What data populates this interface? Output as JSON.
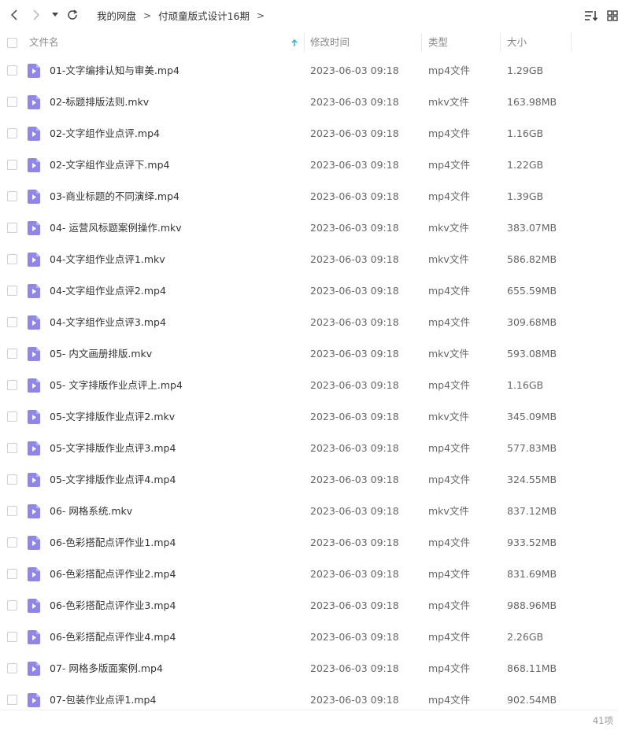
{
  "nav": {
    "back_icon": "chevron-left-icon",
    "forward_icon": "chevron-right-icon",
    "history_icon": "caret-down-icon",
    "refresh_icon": "refresh-icon"
  },
  "breadcrumb": {
    "items": [
      "我的网盘",
      "付顽童版式设计16期"
    ],
    "separator": ">"
  },
  "toolbar": {
    "sort_icon": "sort-list-icon",
    "view_icon": "grid-view-icon"
  },
  "columns": {
    "name": "文件名",
    "modified": "修改时间",
    "type": "类型",
    "size": "大小",
    "sort_icon": "sort-ascending-arrow-icon"
  },
  "colors": {
    "file_icon": "#8f86e8",
    "sort_arrow": "#2aa7c9"
  },
  "files": [
    {
      "name": "01-文字编排认知与审美.mp4",
      "modified": "2023-06-03 09:18",
      "type": "mp4文件",
      "size": "1.29GB"
    },
    {
      "name": "02-标题排版法则.mkv",
      "modified": "2023-06-03 09:18",
      "type": "mkv文件",
      "size": "163.98MB"
    },
    {
      "name": "02-文字组作业点评.mp4",
      "modified": "2023-06-03 09:18",
      "type": "mp4文件",
      "size": "1.16GB"
    },
    {
      "name": "02-文字组作业点评下.mp4",
      "modified": "2023-06-03 09:18",
      "type": "mp4文件",
      "size": "1.22GB"
    },
    {
      "name": "03-商业标题的不同演绎.mp4",
      "modified": "2023-06-03 09:18",
      "type": "mp4文件",
      "size": "1.39GB"
    },
    {
      "name": "04- 运营风标题案例操作.mkv",
      "modified": "2023-06-03 09:18",
      "type": "mkv文件",
      "size": "383.07MB"
    },
    {
      "name": "04-文字组作业点评1.mkv",
      "modified": "2023-06-03 09:18",
      "type": "mkv文件",
      "size": "586.82MB"
    },
    {
      "name": "04-文字组作业点评2.mp4",
      "modified": "2023-06-03 09:18",
      "type": "mp4文件",
      "size": "655.59MB"
    },
    {
      "name": "04-文字组作业点评3.mp4",
      "modified": "2023-06-03 09:18",
      "type": "mp4文件",
      "size": "309.68MB"
    },
    {
      "name": "05- 内文画册排版.mkv",
      "modified": "2023-06-03 09:18",
      "type": "mkv文件",
      "size": "593.08MB"
    },
    {
      "name": "05- 文字排版作业点评上.mp4",
      "modified": "2023-06-03 09:18",
      "type": "mp4文件",
      "size": "1.16GB"
    },
    {
      "name": "05-文字排版作业点评2.mkv",
      "modified": "2023-06-03 09:18",
      "type": "mkv文件",
      "size": "345.09MB"
    },
    {
      "name": "05-文字排版作业点评3.mp4",
      "modified": "2023-06-03 09:18",
      "type": "mp4文件",
      "size": "577.83MB"
    },
    {
      "name": "05-文字排版作业点评4.mp4",
      "modified": "2023-06-03 09:18",
      "type": "mp4文件",
      "size": "324.55MB"
    },
    {
      "name": "06- 网格系统.mkv",
      "modified": "2023-06-03 09:18",
      "type": "mkv文件",
      "size": "837.12MB"
    },
    {
      "name": "06-色彩搭配点评作业1.mp4",
      "modified": "2023-06-03 09:18",
      "type": "mp4文件",
      "size": "933.52MB"
    },
    {
      "name": "06-色彩搭配点评作业2.mp4",
      "modified": "2023-06-03 09:18",
      "type": "mp4文件",
      "size": "831.69MB"
    },
    {
      "name": "06-色彩搭配点评作业3.mp4",
      "modified": "2023-06-03 09:18",
      "type": "mp4文件",
      "size": "988.96MB"
    },
    {
      "name": "06-色彩搭配点评作业4.mp4",
      "modified": "2023-06-03 09:18",
      "type": "mp4文件",
      "size": "2.26GB"
    },
    {
      "name": "07- 网格多版面案例.mp4",
      "modified": "2023-06-03 09:18",
      "type": "mp4文件",
      "size": "868.11MB"
    },
    {
      "name": "07-包装作业点评1.mp4",
      "modified": "2023-06-03 09:18",
      "type": "mp4文件",
      "size": "902.54MB"
    }
  ],
  "footer": {
    "item_count": "41项"
  }
}
